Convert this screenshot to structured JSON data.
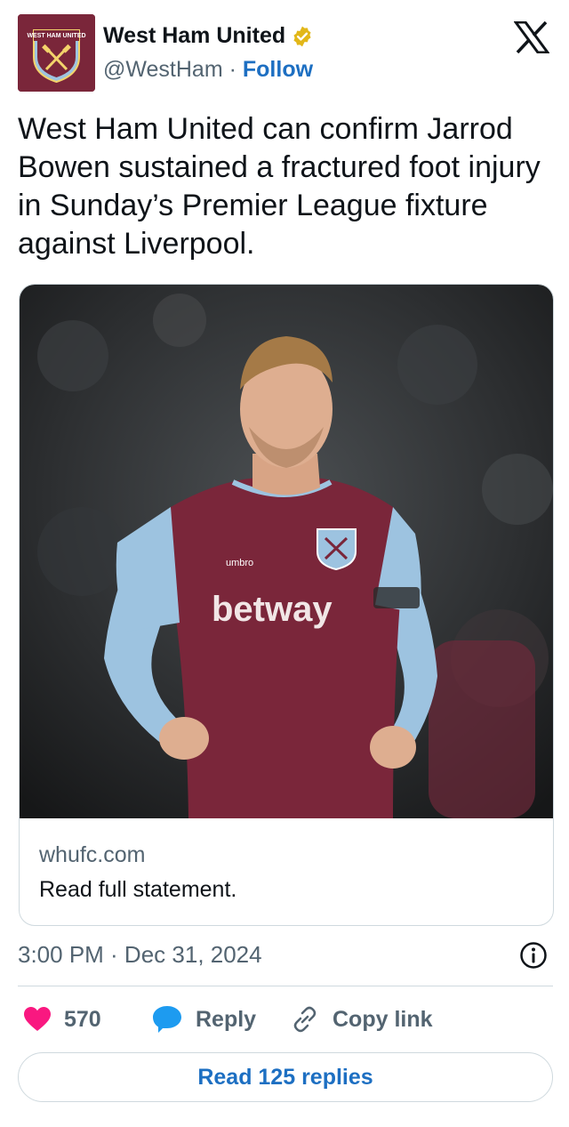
{
  "author": {
    "display_name": "West Ham United",
    "handle": "@WestHam",
    "separator": "·",
    "follow_label": "Follow",
    "avatar_crest_text": "WEST HAM UNITED",
    "verified_color": "#e2b719"
  },
  "tweet": {
    "text": "West Ham United can confirm Jarrod Bowen sustained a fractured foot injury in Sunday’s Premier League fixture against Liverpool."
  },
  "card": {
    "image_subject": "player-photo",
    "sponsor_text": "betway",
    "kit_brand_text": "umbro",
    "domain": "whufc.com",
    "description": "Read full statement."
  },
  "meta": {
    "timestamp": "3:00 PM · Dec 31, 2024"
  },
  "actions": {
    "like_count": "570",
    "reply_label": "Reply",
    "copy_label": "Copy link"
  },
  "footer": {
    "read_replies_label": "Read 125 replies"
  },
  "colors": {
    "like": "#f91880",
    "reply": "#1d9bf0",
    "link": "#1d6fc2",
    "claret": "#7a263a",
    "sky_blue": "#9dc3e0"
  }
}
